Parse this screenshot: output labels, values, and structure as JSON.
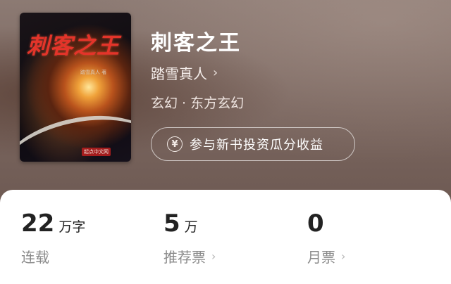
{
  "book": {
    "title": "刺客之王",
    "author": "踏雪真人",
    "genre": "玄幻 · 东方玄幻",
    "invest_label": "参与新书投资瓜分收益"
  },
  "cover": {
    "title_text": "刺客之王",
    "author_text": "踏雪真人 著",
    "publisher_text": "起点中文网"
  },
  "icons": {
    "author_chevron": "chevron-right-icon",
    "yen": "yen-circle-icon"
  },
  "stats": [
    {
      "value": "22",
      "unit": "万字",
      "label": "连载"
    },
    {
      "value": "5",
      "unit": "万",
      "label": "推荐票"
    },
    {
      "value": "0",
      "unit": "",
      "label": "月票"
    }
  ],
  "colors": {
    "header_bg": "#7d6a63",
    "cover_title": "#e4342a",
    "stat_value": "#222222",
    "stat_label": "#8a8a8a"
  }
}
